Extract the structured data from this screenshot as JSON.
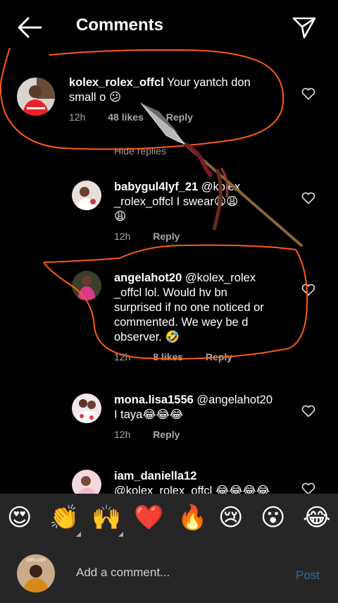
{
  "header": {
    "title": "Comments"
  },
  "comments": [
    {
      "username": "kolex_rolex_offcl",
      "text_line1": " Your yantch don",
      "text_line2": "small o 😕",
      "time": "12h",
      "likes": "48 likes",
      "reply": "Reply"
    },
    {
      "username": "babygul4lyf_21",
      "text_line1": " @kolex",
      "text_line2": "_rolex_offcl I swear😩😩",
      "text_line3": "😩",
      "time": "12h",
      "reply": "Reply"
    },
    {
      "username": "angelahot20",
      "text_line1": " @kolex_rolex",
      "text_line2": "_offcl lol. Would hv bn",
      "text_line3": "surprised if no one noticed or",
      "text_line4": "commented.  We wey be d",
      "text_line5": "observer. 🤣",
      "time": "12h",
      "likes": "8 likes",
      "reply": "Reply"
    },
    {
      "username": "mona.lisa1556",
      "text_line1": " @angelahot20",
      "text_line2": "I taya😂😂😂",
      "time": "12h",
      "reply": "Reply"
    },
    {
      "username": "iam_daniella12",
      "text_line1": "@kolex_rolex_offcl 😂😂😂😂"
    }
  ],
  "hide_replies": "Hide replies",
  "emoji_bar": [
    "😍",
    "👏",
    "🙌",
    "❤️",
    "🔥",
    "😢",
    "😮",
    "😂"
  ],
  "compose": {
    "placeholder": "Add a comment...",
    "post": "Post",
    "avatar_text": "GIRLUSH"
  },
  "colors": {
    "annotation": "#ff5a14",
    "post": "#2f6c9c",
    "bar": "#262626"
  }
}
